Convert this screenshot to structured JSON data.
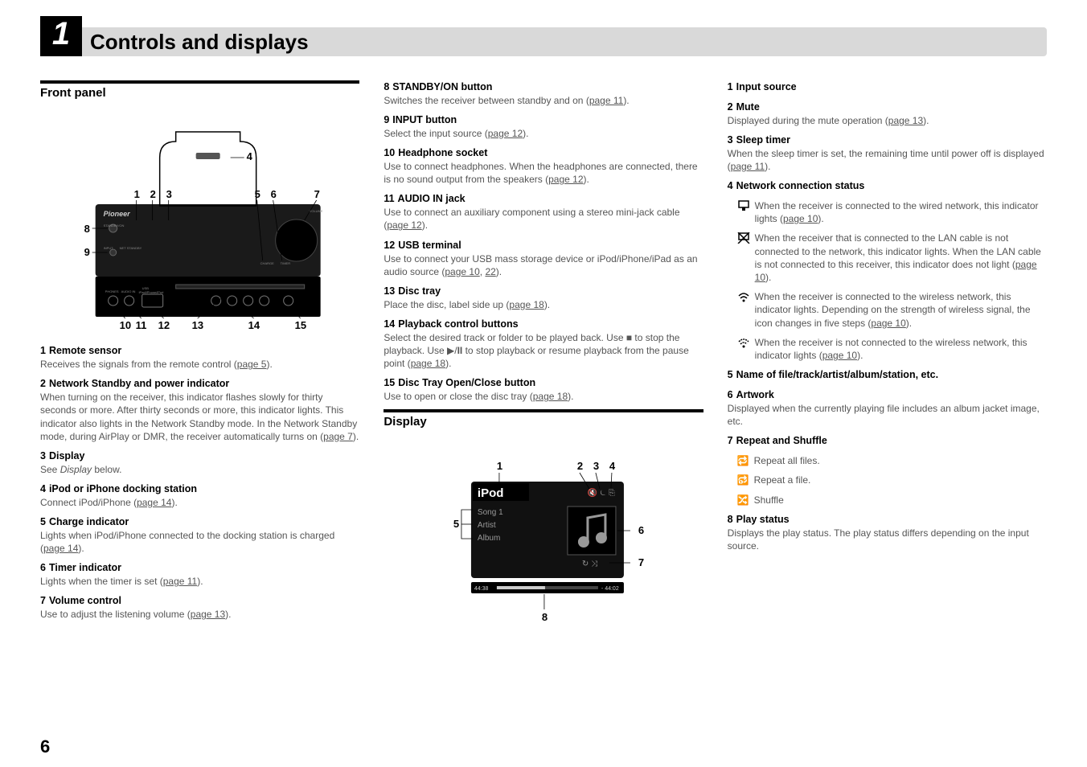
{
  "chapter": {
    "number": "1",
    "title": "Controls and displays"
  },
  "page_number": "6",
  "col1": {
    "section": "Front panel",
    "items": [
      {
        "n": "1",
        "title": "Remote sensor",
        "body": "Receives the signals from the remote control (",
        "ref": "page 5",
        "tail": ")."
      },
      {
        "n": "2",
        "title": "Network Standby and power indicator",
        "body": "When turning on the receiver, this indicator flashes slowly for thirty seconds or more. After thirty seconds or more, this indicator lights. This indicator also lights in the Network Standby mode. In the  Network Standby mode, during AirPlay or DMR, the receiver automatically turns on (",
        "ref": "page 7",
        "tail": ")."
      },
      {
        "n": "3",
        "title": "Display",
        "body_html": "See <i>Display</i> below."
      },
      {
        "n": "4",
        "title": "iPod or iPhone docking station",
        "body": "Connect iPod/iPhone (",
        "ref": "page 14",
        "tail": ")."
      },
      {
        "n": "5",
        "title": "Charge indicator",
        "body": "Lights when iPod/iPhone connected to the docking station is charged (",
        "ref": "page 14",
        "tail": ")."
      },
      {
        "n": "6",
        "title": "Timer indicator",
        "body": "Lights when the timer is set (",
        "ref": "page 11",
        "tail": ")."
      },
      {
        "n": "7",
        "title": "Volume control",
        "body": "Use to adjust the listening volume (",
        "ref": "page 13",
        "tail": ")."
      }
    ]
  },
  "col2": {
    "items": [
      {
        "n": "8",
        "title": "STANDBY/ON button",
        "body": "Switches the receiver between standby and on (",
        "ref": "page 11",
        "tail": ")."
      },
      {
        "n": "9",
        "title": "INPUT button",
        "body": "Select the input source (",
        "ref": "page 12",
        "tail": ")."
      },
      {
        "n": "10",
        "title": "Headphone socket",
        "body": "Use to connect headphones. When the headphones are connected, there is no sound output from the speakers (",
        "ref": "page 12",
        "tail": ")."
      },
      {
        "n": "11",
        "title": "AUDIO IN jack",
        "body": "Use to connect an auxiliary component using a stereo mini-jack cable (",
        "ref": "page 12",
        "tail": ")."
      },
      {
        "n": "12",
        "title": "USB terminal",
        "body": "Use to connect your USB mass storage device or iPod/iPhone/iPad as an audio source (",
        "ref": "page 10",
        "ref2": "22",
        "tail": ")."
      },
      {
        "n": "13",
        "title": "Disc tray",
        "body": "Place the disc, label side up (",
        "ref": "page 18",
        "tail": ")."
      },
      {
        "n": "14",
        "title": "Playback control buttons",
        "body_html": "Select the desired track or folder to be played back. Use ■ to stop the playback. Use ▶/<b>II</b> to stop playback or resume playback from the pause point (<a class='page-ref'>page 18</a>)."
      },
      {
        "n": "15",
        "title": "Disc Tray Open/Close button",
        "body": "Use to open or close the disc tray (",
        "ref": "page 18",
        "tail": ")."
      }
    ],
    "section2": "Display",
    "display_labels": {
      "title": "iPod",
      "l1": "Song 1",
      "l2": "Artist",
      "l3": "Album",
      "time_l": "44:38",
      "time_r": "- 44:02"
    }
  },
  "col3": {
    "items_top": [
      {
        "n": "1",
        "title": "Input source"
      },
      {
        "n": "2",
        "title": "Mute",
        "body": "Displayed during the mute operation (",
        "ref": "page 13",
        "tail": ")."
      },
      {
        "n": "3",
        "title": "Sleep timer",
        "body": "When the sleep timer is set, the remaining time until power off is displayed (",
        "ref": "page 11",
        "tail": ")."
      },
      {
        "n": "4",
        "title": "Network connection status"
      }
    ],
    "net_status": [
      {
        "text": "When the receiver is connected to the wired network, this indicator lights (",
        "ref": "page 10",
        "tail": ")."
      },
      {
        "text": "When the receiver that is connected to the LAN cable is not connected to the network, this indicator lights. When the LAN cable is not connected to this receiver, this indicator does not light (",
        "ref": "page 10",
        "tail": ")."
      },
      {
        "text": "When the receiver is connected to the wireless network, this indicator lights. Depending on the strength of wireless signal, the icon changes in five steps (",
        "ref": "page 10",
        "tail": ")."
      },
      {
        "text": "When the receiver is not connected to the wireless network, this indicator lights (",
        "ref": "page 10",
        "tail": ")."
      }
    ],
    "items_bottom": [
      {
        "n": "5",
        "title": "Name of file/track/artist/album/station, etc."
      },
      {
        "n": "6",
        "title": "Artwork",
        "body": "Displayed when the currently playing file includes an album jacket image, etc."
      },
      {
        "n": "7",
        "title": "Repeat and Shuffle"
      }
    ],
    "repeat_lines": [
      {
        "label": "Repeat all files."
      },
      {
        "label": "Repeat a file."
      },
      {
        "label": "Shuffle"
      }
    ],
    "item8": {
      "n": "8",
      "title": "Play status",
      "body": "Displays the play status. The play status differs depending on the input source."
    }
  }
}
